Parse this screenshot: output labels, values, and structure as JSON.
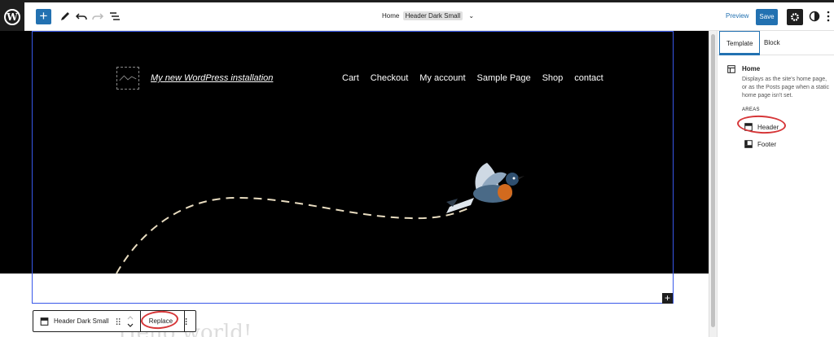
{
  "toolbar": {
    "document_title": "Home",
    "template_badge": "Header Dark Small",
    "preview_label": "Preview",
    "save_label": "Save"
  },
  "canvas": {
    "site_title": "My new WordPress installation",
    "nav": [
      "Cart",
      "Checkout",
      "My account",
      "Sample Page",
      "Shop",
      "contact"
    ],
    "next_post_title": "Hello world!"
  },
  "block_toolbar": {
    "block_name": "Header Dark Small",
    "replace_label": "Replace"
  },
  "sidebar": {
    "tabs": [
      "Template",
      "Block"
    ],
    "template_name": "Home",
    "template_description": "Displays as the site's home page, or as the Posts page when a static home page isn't set.",
    "areas_heading": "AREAS",
    "areas": [
      "Header",
      "Footer"
    ]
  },
  "colors": {
    "accent": "#2271b1",
    "annotation": "#d63638",
    "header_background": "#000000"
  }
}
